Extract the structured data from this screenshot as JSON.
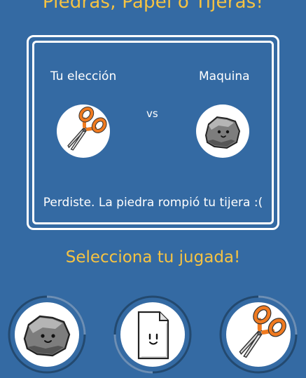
{
  "game": {
    "title": "Piedras, Papel o Tijeras!",
    "player_label": "Tu elección",
    "machine_label": "Maquina",
    "vs_label": "vs",
    "player_choice_icon": "scissors-icon",
    "machine_choice_icon": "rock-icon",
    "result_text": "Perdiste. La piedra rompió tu tijera :(",
    "prompt": "Selecciona tu jugada!"
  },
  "options": [
    {
      "name": "piedra",
      "icon": "rock-icon"
    },
    {
      "name": "papel",
      "icon": "paper-icon"
    },
    {
      "name": "tijera",
      "icon": "scissors-icon"
    }
  ],
  "colors": {
    "background": "#346aa3",
    "title": "#f6c342",
    "text": "#ffffff",
    "scissors_handle": "#f07a1f",
    "rock": "#8a8a8a"
  }
}
